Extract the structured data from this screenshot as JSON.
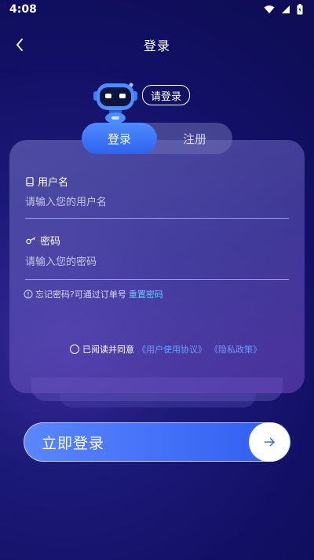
{
  "status": {
    "time": "4:08"
  },
  "header": {
    "title": "登录"
  },
  "bubble": {
    "text": "请登录"
  },
  "tabs": [
    {
      "label": "登录"
    },
    {
      "label": "注册"
    }
  ],
  "form": {
    "username": {
      "label": "用户名",
      "placeholder": "请输入您的用户名",
      "value": ""
    },
    "password": {
      "label": "密码",
      "placeholder": "请输入您的密码",
      "value": ""
    }
  },
  "hint": {
    "text": "忘记密码?可通过订单号",
    "link": "重置密码"
  },
  "agreement": {
    "text": "已阅读并同意",
    "user_agreement": "《用户使用协议》",
    "privacy": "《隐私政策》"
  },
  "login_button": {
    "label": "立即登录"
  },
  "colors": {
    "accent": "#2f62f0",
    "link": "#6cc4ff",
    "background": "#121066"
  },
  "icons": [
    "back-chevron-icon",
    "wifi-icon",
    "signal-icon",
    "battery-icon",
    "robot-mascot",
    "phone-icon",
    "key-icon",
    "info-icon",
    "arrow-right-icon"
  ]
}
